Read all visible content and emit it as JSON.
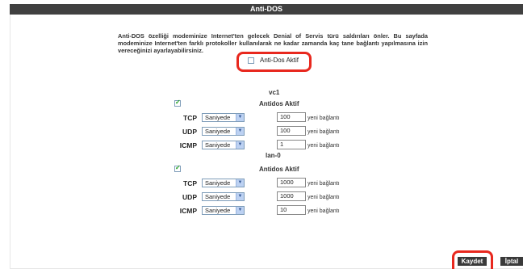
{
  "header": {
    "title": "Anti-DOS"
  },
  "description": "Anti-DOS özelliği modeminize Internet'ten gelecek Denial of Servis türü saldırıları önler. Bu sayfada modeminize Internet'ten farklı protokoller kullanılarak ne kadar zamanda kaç tane bağlantı yapılmasına izin vereceğinizi ayarlayabilirsiniz.",
  "global_toggle": {
    "label": "Anti-Dos Aktif",
    "checked": false
  },
  "interfaces": [
    {
      "name": "vc1",
      "enable_label": "Antidos Aktif",
      "checked": true,
      "rows": [
        {
          "protocol": "TCP",
          "unit": "Saniyede",
          "value": "100",
          "suffix": "yeni bağlantı"
        },
        {
          "protocol": "UDP",
          "unit": "Saniyede",
          "value": "100",
          "suffix": "yeni bağlantı"
        },
        {
          "protocol": "ICMP",
          "unit": "Saniyede",
          "value": "1",
          "suffix": "yeni bağlantı"
        }
      ]
    },
    {
      "name": "lan-0",
      "enable_label": "Antidos Aktif",
      "checked": true,
      "rows": [
        {
          "protocol": "TCP",
          "unit": "Saniyede",
          "value": "1000",
          "suffix": "yeni bağlantı"
        },
        {
          "protocol": "UDP",
          "unit": "Saniyede",
          "value": "1000",
          "suffix": "yeni bağlantı"
        },
        {
          "protocol": "ICMP",
          "unit": "Saniyede",
          "value": "10",
          "suffix": "yeni bağlantı"
        }
      ]
    }
  ],
  "buttons": {
    "save": "Kaydet",
    "cancel": "İptal"
  },
  "colors": {
    "highlight": "#e8281e",
    "bar": "#404040",
    "checkmark": "#21a121"
  }
}
